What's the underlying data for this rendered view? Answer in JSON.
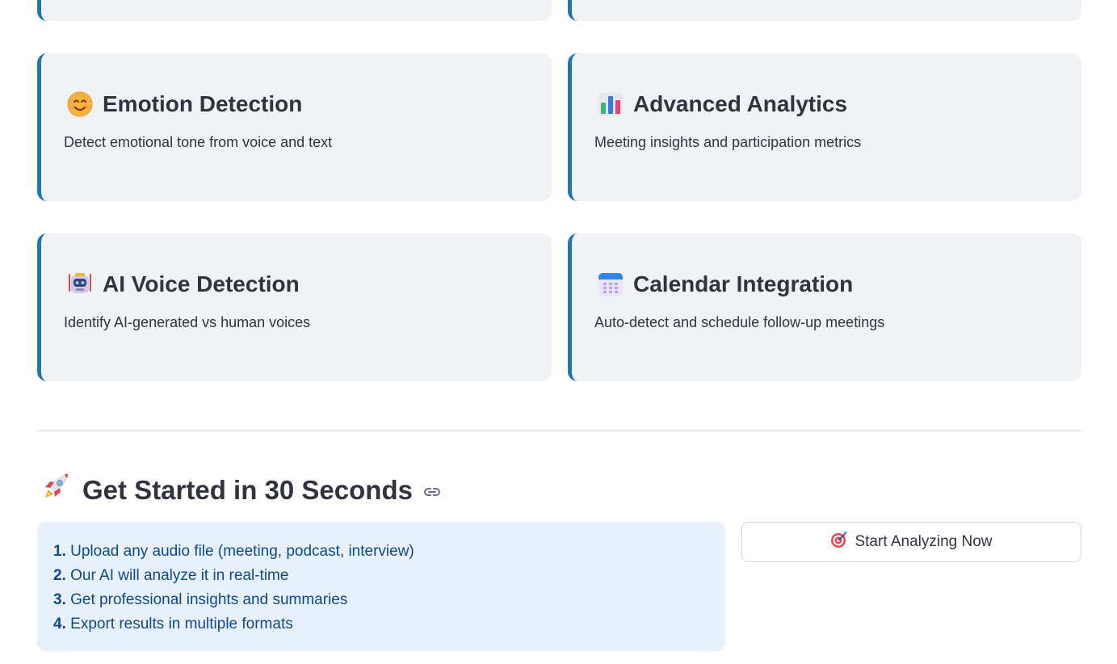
{
  "features": [
    {
      "title": "Emotion Detection",
      "description": "Detect emotional tone from voice and text",
      "icon": "smiling-face-icon"
    },
    {
      "title": "Advanced Analytics",
      "description": "Meeting insights and participation metrics",
      "icon": "bar-chart-icon"
    },
    {
      "title": "AI Voice Detection",
      "description": "Identify AI-generated vs human voices",
      "icon": "robot-icon"
    },
    {
      "title": "Calendar Integration",
      "description": "Auto-detect and schedule follow-up meetings",
      "icon": "calendar-icon"
    }
  ],
  "get_started": {
    "title": "Get Started in 30 Seconds",
    "icon": "rocket-icon",
    "steps": [
      {
        "num": "1.",
        "text": "Upload any audio file (meeting, podcast, interview)"
      },
      {
        "num": "2.",
        "text": "Our AI will analyze it in real-time"
      },
      {
        "num": "3.",
        "text": "Get professional insights and summaries"
      },
      {
        "num": "4.",
        "text": "Export results in multiple formats"
      }
    ],
    "cta_label": "Start Analyzing Now",
    "cta_icon": "target-icon"
  },
  "colors": {
    "accent": "#1f77b4",
    "card_bg": "#f0f2f6",
    "info_bg": "#e7f0fb",
    "info_text": "#0e4a84"
  }
}
